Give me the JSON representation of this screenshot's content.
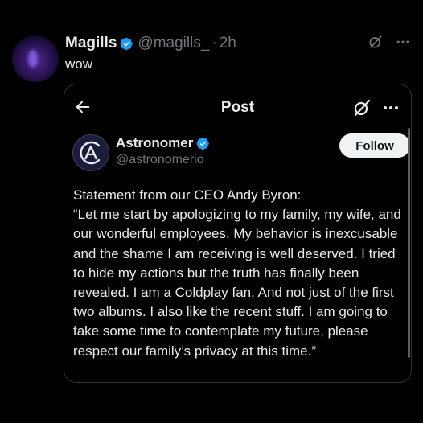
{
  "reply": {
    "name": "Magills",
    "handle": "@magills_",
    "dot": "·",
    "time": "2h",
    "text": "wow",
    "icons": [
      "grok-icon",
      "more-icon"
    ]
  },
  "card": {
    "title": "Post",
    "author": {
      "name": "Astronomer",
      "handle": "@astronomerio",
      "follow_label": "Follow"
    },
    "body_lines": [
      "Statement from our CEO Andy Byron:",
      "“Let me start by apologizing to my family, my wife, and our wonderful employees. My behavior is inexcusable and the shame I am receiving is well deserved. I tried to hide my actions but the truth has finally been revealed. I am a Coldplay fan. And not just of the first two albums. I also like the recent stuff. I am going to take some time to contemplate my future, please respect our family’s privacy at this time.”"
    ],
    "icons": [
      "back-arrow-icon",
      "grok-icon",
      "more-icon"
    ]
  },
  "colors": {
    "background": "#000000",
    "text": "#e7e9ea",
    "muted": "#71767b",
    "verified": "#1d9bf0",
    "follow_bg": "#eff3f4"
  }
}
